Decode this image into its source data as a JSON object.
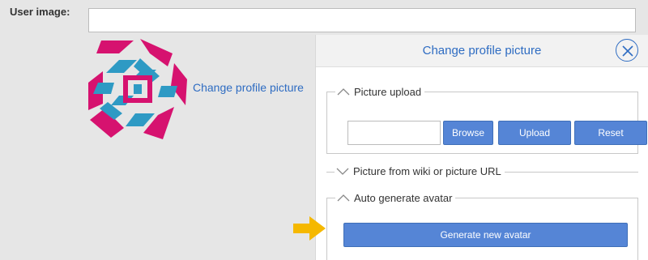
{
  "form": {
    "user_image_label": "User image:",
    "user_image_value": ""
  },
  "profile": {
    "change_link": "Change profile picture",
    "avatar_colors": [
      "#d6126f",
      "#2e9ac4"
    ]
  },
  "dialog": {
    "title": "Change profile picture",
    "close_icon": "close-icon",
    "sections": {
      "upload": {
        "label": "Picture upload",
        "state": "expanded",
        "file_value": "",
        "browse": "Browse",
        "upload": "Upload",
        "reset": "Reset"
      },
      "wiki_url": {
        "label": "Picture from wiki or picture URL",
        "state": "collapsed"
      },
      "auto_avatar": {
        "label": "Auto generate avatar",
        "state": "expanded",
        "generate": "Generate new avatar"
      }
    },
    "accent_color": "#2e6cc2",
    "button_color": "#5585d6",
    "pointer_arrow_color": "#f5b800"
  }
}
